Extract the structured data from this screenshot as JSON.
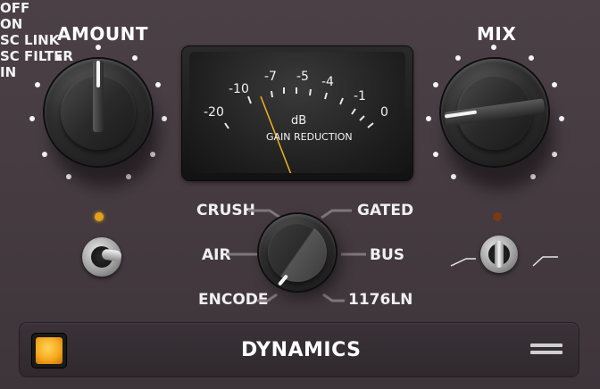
{
  "amount": {
    "title": "AMOUNT"
  },
  "mix": {
    "title": "MIX"
  },
  "meter": {
    "scale": [
      "-20",
      "-10",
      "-7",
      "-5",
      "-4",
      "-1",
      "0"
    ],
    "unit": "dB",
    "caption": "GAIN REDUCTION",
    "needle_color": "#f2b21a"
  },
  "mode": {
    "options_left": [
      "CRUSH",
      "AIR",
      "ENCODE"
    ],
    "options_right": [
      "GATED",
      "BUS",
      "1176LN"
    ]
  },
  "sc_link": {
    "label": "SC LINK",
    "off": "OFF",
    "on": "ON",
    "led_color": "#e0a21a"
  },
  "sc_filter": {
    "label": "SC FILTER",
    "led_color": "#7a3a14"
  },
  "footer": {
    "in_label": "IN",
    "title": "DYNAMICS",
    "in_color": "#f6a81c"
  },
  "icons": [
    "hamburger-menu-icon",
    "highpass-filter-icon",
    "flat-filter-icon"
  ]
}
